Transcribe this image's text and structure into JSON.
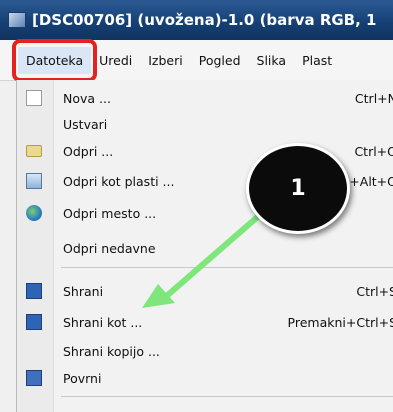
{
  "window": {
    "title": "[DSC00706] (uvožena)-1.0 (barva RGB, 1"
  },
  "menubar": {
    "items": [
      "Datoteka",
      "Uredi",
      "Izberi",
      "Pogled",
      "Slika",
      "Plast"
    ],
    "active": "Datoteka"
  },
  "file_menu": {
    "items": [
      {
        "label": "Nova ...",
        "shortcut": "Ctrl+N",
        "icon": "new-file-icon"
      },
      {
        "label": "Ustvari",
        "shortcut": "",
        "icon": ""
      },
      {
        "label": "Odpri ...",
        "shortcut": "Ctrl+O",
        "icon": "folder-open-icon"
      },
      {
        "label": "Odpri kot plasti ...",
        "shortcut": "Ctrl+Alt+O",
        "icon": "layers-icon"
      },
      {
        "label": "Odpri mesto ...",
        "shortcut": "",
        "icon": "globe-icon"
      },
      {
        "label": "Odpri nedavne",
        "shortcut": "",
        "icon": ""
      },
      {
        "label": "Shrani",
        "shortcut": "Ctrl+S",
        "icon": "save-icon"
      },
      {
        "label": "Shrani kot ...",
        "shortcut": "Premakni+Ctrl+S",
        "icon": "save-as-icon"
      },
      {
        "label": "Shrani kopijo ...",
        "shortcut": "",
        "icon": ""
      },
      {
        "label": "Povrni",
        "shortcut": "",
        "icon": "revert-icon"
      }
    ]
  },
  "annotation": {
    "step_number": "1",
    "highlight_color": "#e52222",
    "arrow_color": "#7ee67a"
  }
}
